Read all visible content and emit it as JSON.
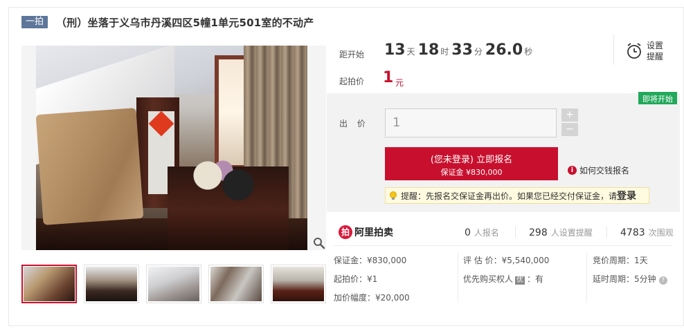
{
  "header": {
    "tag": "一拍",
    "title": "（刑）坐落于义乌市丹溪四区5幢1单元501室的不动产"
  },
  "countdown": {
    "label": "距开始",
    "days": "13",
    "days_unit": "天",
    "hours": "18",
    "hours_unit": "时",
    "minutes": "33",
    "minutes_unit": "分",
    "seconds": "26.0",
    "seconds_unit": "秒"
  },
  "starting_price": {
    "label": "起拍价",
    "value": "1",
    "unit": "元"
  },
  "reminder": {
    "label_line1": "设置",
    "label_line2": "提醒"
  },
  "bid": {
    "badge": "即将开始",
    "label": "出 价",
    "input_value": "1",
    "step_up": "+",
    "step_down": "−",
    "signup_main": "(您未登录) 立即报名",
    "signup_sub": "保证金 ¥830,000",
    "how_pay": "如何交钱报名",
    "tip_text": "提醒：先报名交保证金再出价。如果您已经交付保证金，请",
    "tip_login": "登录"
  },
  "brand": {
    "logo_mark": "拍",
    "name": "阿里拍卖"
  },
  "stats": {
    "signups_num": "0",
    "signups_label": "人报名",
    "reminders_num": "298",
    "reminders_label": "人设置提醒",
    "views_num": "4783",
    "views_label": "次围观"
  },
  "details": {
    "deposit": "保证金：¥830,000",
    "start_price": "起拍价：¥1",
    "increment": "加价幅度：¥20,000",
    "appraisal": "评 估 价：¥5,540,000",
    "priority_label": "优先购买权人",
    "priority_badge": "优",
    "priority_value": "：有",
    "period": "竞价周期：1天",
    "delay": "延时周期：5分钟",
    "help_mark": "?"
  },
  "colors": {
    "accent_red": "#c8102e",
    "tag_blue": "#5d7699",
    "badge_green": "#22a95b"
  }
}
